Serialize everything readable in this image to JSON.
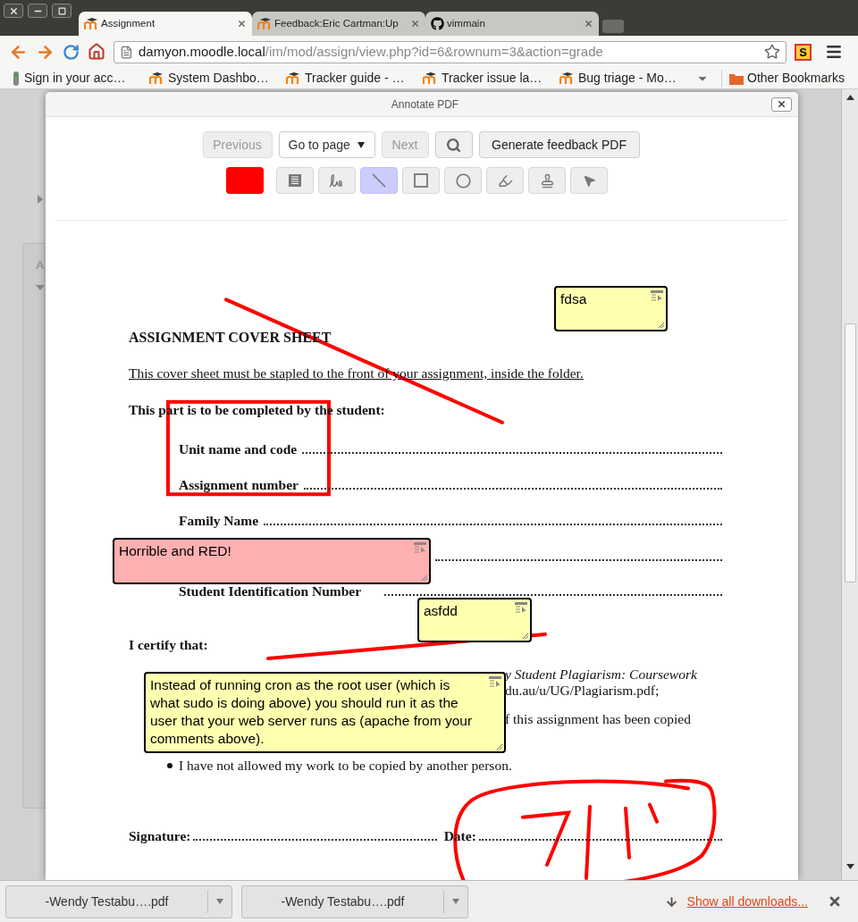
{
  "tabs": [
    {
      "title": "Assignment",
      "kind": "moodle",
      "selected": true
    },
    {
      "title": "Feedback:Eric Cartman:Up",
      "kind": "moodle",
      "selected": false
    },
    {
      "title": "vimmain",
      "kind": "github",
      "selected": false
    }
  ],
  "address_bar": {
    "host": "damyon.moodle.local",
    "path": "/im/mod/assign/view.php?id=6&rownum=3&action=grade"
  },
  "extension_label": "S",
  "bookmarks": [
    {
      "label": "Sign in your acc…",
      "kind": "page"
    },
    {
      "label": "System Dashbo…",
      "kind": "moodle"
    },
    {
      "label": "Tracker guide - …",
      "kind": "moodle"
    },
    {
      "label": "Tracker issue la…",
      "kind": "moodle"
    },
    {
      "label": "Bug triage - Mo…",
      "kind": "moodle"
    }
  ],
  "other_bookmarks": "Other Bookmarks",
  "background_page": {
    "block_label": "A"
  },
  "dialog": {
    "title": "Annotate PDF",
    "navigation": {
      "previous": {
        "label": "Previous",
        "disabled": true
      },
      "page_select": "Go to page",
      "next": {
        "label": "Next",
        "disabled": true
      },
      "generate": "Generate feedback PDF"
    },
    "color": "#ff0000",
    "tools": [
      {
        "kind": "comment",
        "selected": false
      },
      {
        "kind": "pen",
        "selected": false
      },
      {
        "kind": "line",
        "selected": true
      },
      {
        "kind": "rectangle",
        "selected": false
      },
      {
        "kind": "oval",
        "selected": false
      },
      {
        "kind": "highlight",
        "selected": false
      },
      {
        "kind": "stamp",
        "selected": false
      },
      {
        "kind": "select",
        "selected": false
      }
    ]
  },
  "document": {
    "heading": "ASSIGNMENT COVER SHEET",
    "instruction": "This cover sheet must be stapled to the front of your assignment, inside the folder.",
    "section_title": "This part is to be completed by the student:",
    "fields": [
      {
        "label": "Unit name and code",
        "covered": false
      },
      {
        "label": "Assignment number",
        "covered": false
      },
      {
        "label": "Family Name",
        "covered": false
      },
      {
        "covered": true
      },
      {
        "label": "Student Identification Number",
        "covered": false
      }
    ],
    "certify_title": "I certify that:",
    "certify_fragments": [
      {
        "text": "y Student Plagiarism: Coursework",
        "italic": true
      },
      {
        "text": "du.au/u/UG/Plagiarism.pdf;",
        "italic": false
      },
      {
        "text": "f this assignment has been copied",
        "italic": false
      }
    ],
    "bullet": "I have not allowed my work to be copied by another person.",
    "signature_label": "Signature:",
    "date_label": "Date:"
  },
  "comments": [
    {
      "text": "fdsa",
      "color": "#ffffb0"
    },
    {
      "text": "Horrible and RED!",
      "color": "#ffb0b0"
    },
    {
      "text": "asfdd",
      "color": "#ffffb0"
    },
    {
      "text": "Instead of running cron as the root user (which is what sudo is doing above) you should run it as the user that your web server runs as (apache from your comments above).",
      "color": "#ffffb0"
    }
  ],
  "downloads": [
    {
      "file": "-Wendy Testabu….pdf"
    },
    {
      "file": "-Wendy Testabu….pdf"
    }
  ],
  "show_all_downloads": "Show all downloads..."
}
